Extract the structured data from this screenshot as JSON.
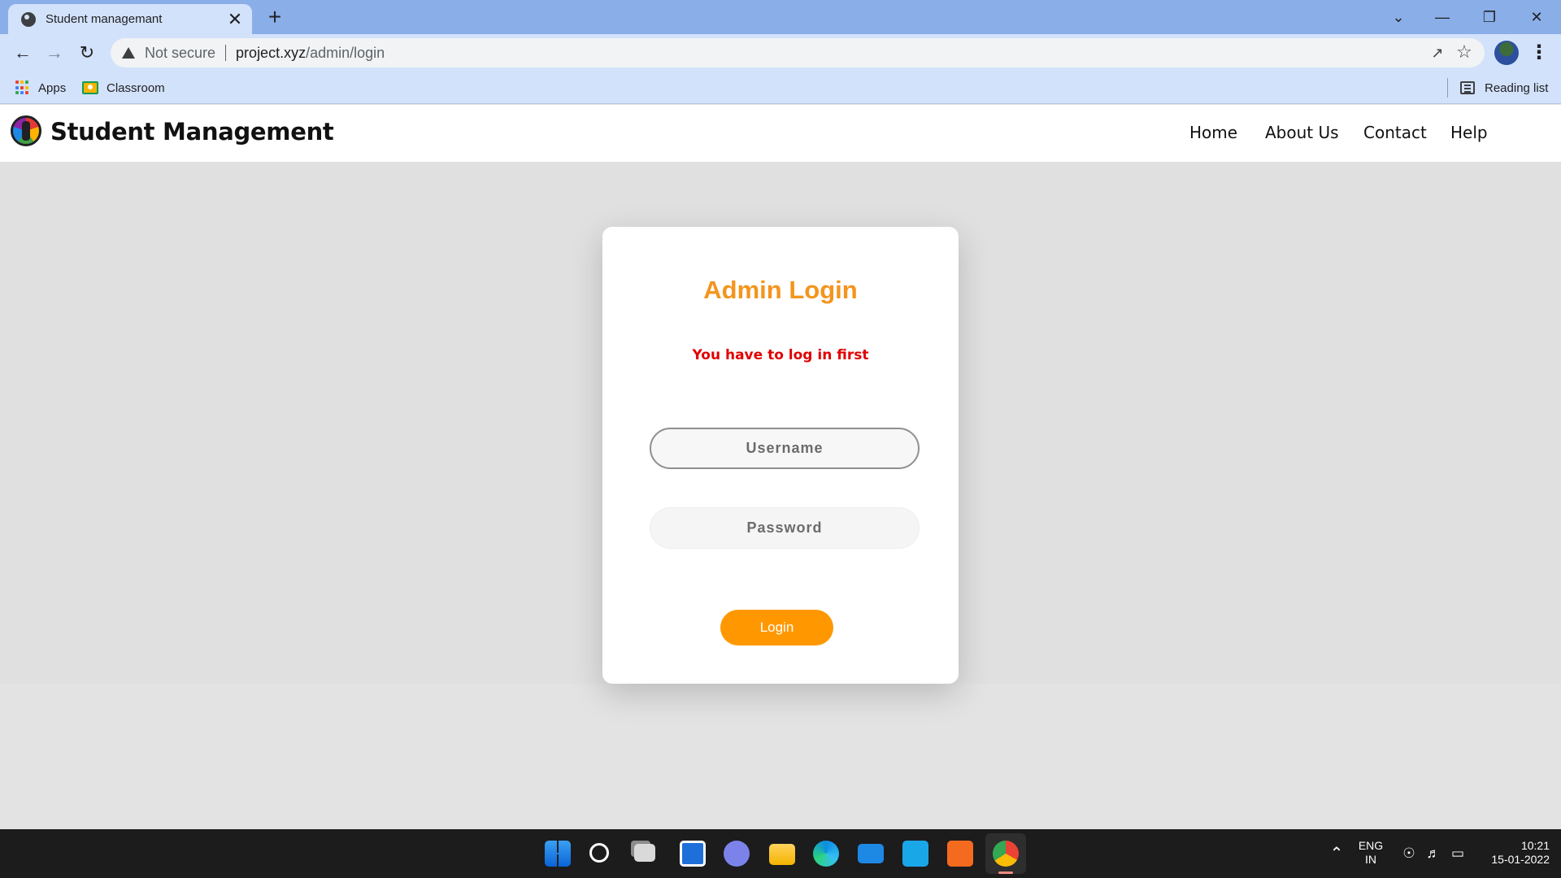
{
  "browser": {
    "tab_title": "Student managemant",
    "tab_close": "✕",
    "new_tab": "+",
    "security_label": "Not secure",
    "url_host": "project.xyz",
    "url_path": "/admin/login",
    "bookmarks": [
      {
        "label": "Apps",
        "icon": "apps-grid-icon"
      },
      {
        "label": "Classroom",
        "icon": "google-classroom-icon"
      }
    ],
    "reading_list": "Reading list"
  },
  "site": {
    "brand": "Student Management",
    "nav": [
      "Home",
      "About Us",
      "Contact",
      "Help"
    ]
  },
  "login": {
    "title": "Admin Login",
    "error": "You have to log in first",
    "username_placeholder": "Username",
    "password_placeholder": "Password",
    "button": "Login"
  },
  "taskbar": {
    "language": "ENG",
    "region": "IN",
    "time": "10:21",
    "date": "15-01-2022",
    "apps": [
      "start-icon",
      "search-icon",
      "task-view-icon",
      "widgets-icon",
      "teams-chat-icon",
      "file-explorer-icon",
      "edge-icon",
      "mail-icon",
      "l-app-icon",
      "xampp-icon",
      "chrome-icon"
    ]
  },
  "colors": {
    "accent": "#ff9800",
    "title": "#f5941d",
    "error": "#e00000",
    "tabstrip": "#8aaee8",
    "toolbar": "#d3e2fb"
  }
}
